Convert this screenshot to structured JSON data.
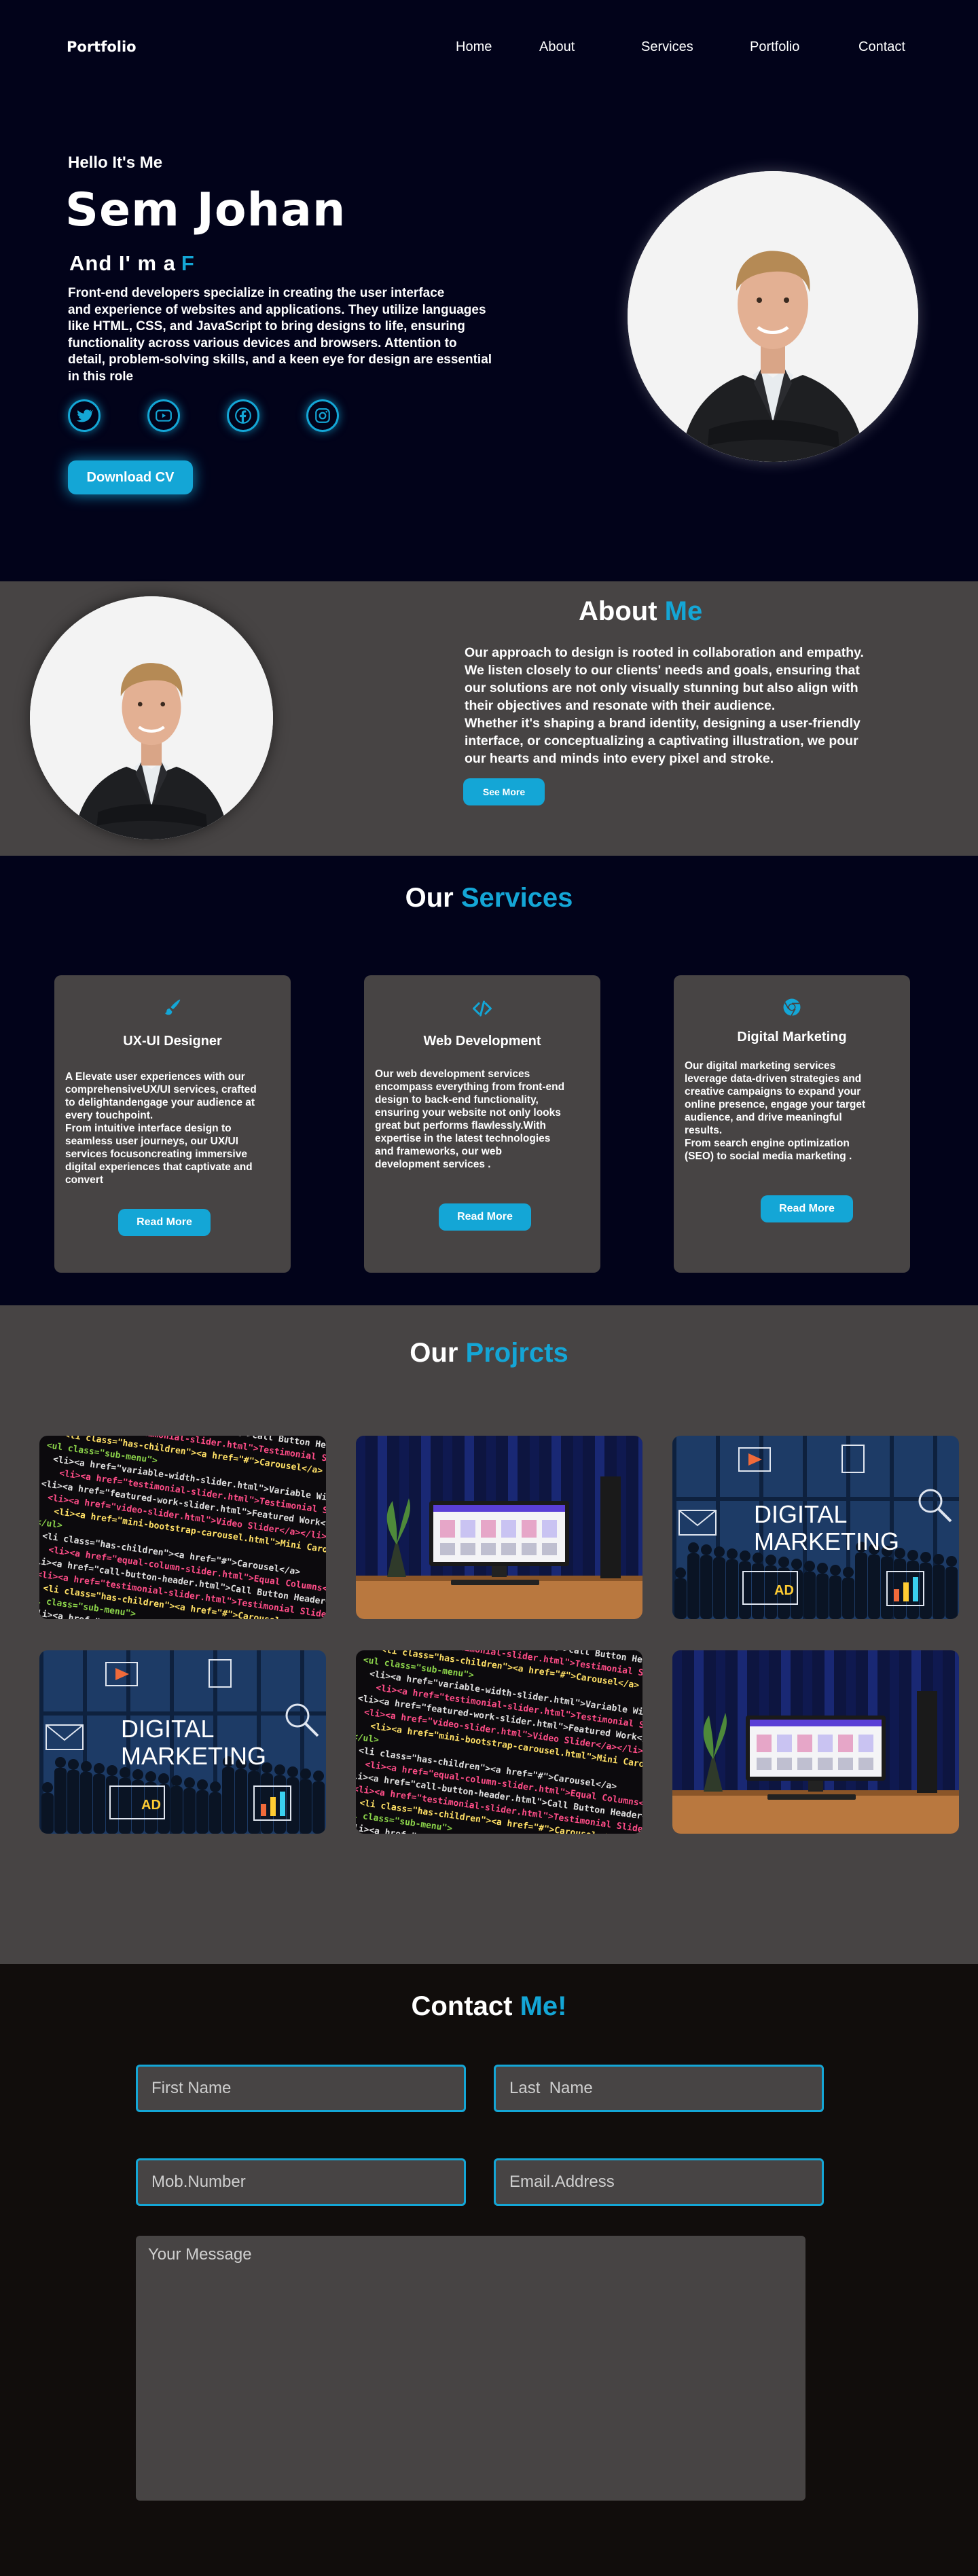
{
  "brand": "Portfolio",
  "nav": [
    "Home",
    "About",
    "Services",
    "Portfolio",
    "Contact"
  ],
  "hero": {
    "greeting": "Hello It's Me",
    "name": "Sem Johan",
    "role_prefix": "And  I' m a",
    "role_typed": "F",
    "description": "Front-end developers specialize in creating the user interface\n and experience of websites and applications. They utilize languages\n like HTML, CSS, and JavaScript to bring designs to life, ensuring\nfunctionality across various devices and browsers. Attention to\n detail, problem-solving skills, and a keen eye for design are essential\nin this role",
    "socials": [
      "twitter-icon",
      "youtube-icon",
      "facebook-icon",
      "instagram-icon"
    ],
    "cv_button": "Download CV"
  },
  "about": {
    "title": "About",
    "title_accent": "Me",
    "description": "Our approach to design is rooted in collaboration and empathy.\nWe listen closely to our clients' needs and goals, ensuring that\nour solutions are not only visually stunning but also align with\ntheir objectives and resonate with their audience.\nWhether it's shaping a brand identity, designing a user-friendly\ninterface, or conceptualizing a captivating illustration, we pour\nour hearts and minds into every pixel and stroke.",
    "button": "See More"
  },
  "services": {
    "title": "Our",
    "title_accent": "Services",
    "cards": [
      {
        "icon": "brush-icon",
        "title": "UX-UI  Designer",
        "description": "A Elevate user experiences with our\ncomprehensiveUX/UI services, crafted\nto delightandengage your audience at\nevery touchpoint.\nFrom intuitive interface design to\nseamless user journeys, our UX/UI\nservices focusoncreating immersive\ndigital experiences that captivate and\nconvert",
        "button": "Read More"
      },
      {
        "icon": "code-icon",
        "title": "Web Development",
        "description": "Our web development services\nencompass everything from front-end\ndesign to back-end functionality,\nensuring your website not only looks\ngreat but performs flawlessly.With\nexpertise in the latest technologies\nand frameworks, our web\ndevelopment services .",
        "button": "Read More"
      },
      {
        "icon": "chrome-icon",
        "title": "Digital Marketing",
        "description": "Our digital marketing services\nleverage data-driven strategies and\ncreative campaigns to expand your\nonline presence, engage your target\naudience, and drive meaningful\nresults.\nFrom search engine optimization\n(SEO) to social media marketing .",
        "button": "Read More"
      }
    ]
  },
  "projects": {
    "title": "Our",
    "title_accent": "Projrcts",
    "items": [
      {
        "type": "code"
      },
      {
        "type": "desk"
      },
      {
        "type": "marketing",
        "line1": "DIGITAL",
        "line2": "MARKETING",
        "badge": "AD"
      },
      {
        "type": "marketing",
        "line1": "DIGITAL",
        "line2": "MARKETING",
        "badge": "AD"
      },
      {
        "type": "code"
      },
      {
        "type": "desk"
      }
    ],
    "code_lines": [
      "<li><a href=\"call-button-header.html\">Call Button Header</a></li>",
      "  <li><a href=\"testimonial-slider.html\">Testimonial Slider</a></li>",
      "  <li class=\"has-children\"><a href=\"#\">Carousel</a>",
      "    <ul class=\"sub-menu\">",
      "      <li><a href=\"variable-width-slider.html\">Variable Width</a></li>",
      "      <li><a href=\"testimonial-slider.html\">Testimonial Slider</a></li>",
      "      <li><a href=\"featured-work-slider.html\">Featured Work</a></li>",
      "      <li><a href=\"video-slider.html\">Video Slider</a></li>",
      "      <li><a href=\"mini-bootstrap-carousel.html\">Mini Carousel</a></li>",
      "    </ul>",
      "  <li class=\"has-children\"><a href=\"#\">Carousel</a>",
      "  <li><a href=\"equal-column-slider.html\">Equal Columns</a></li>"
    ]
  },
  "contact": {
    "title": "Contact",
    "title_accent": "Me!",
    "first_name": "First Name",
    "last_name": "Last  Name",
    "mobile": "Mob.Number",
    "email": "Email.Address",
    "message": "Your Message"
  },
  "colors": {
    "accent": "#14a6d6",
    "hero_bg": "#02031a",
    "section_gray": "#474444",
    "contact_bg": "#110d0c"
  }
}
